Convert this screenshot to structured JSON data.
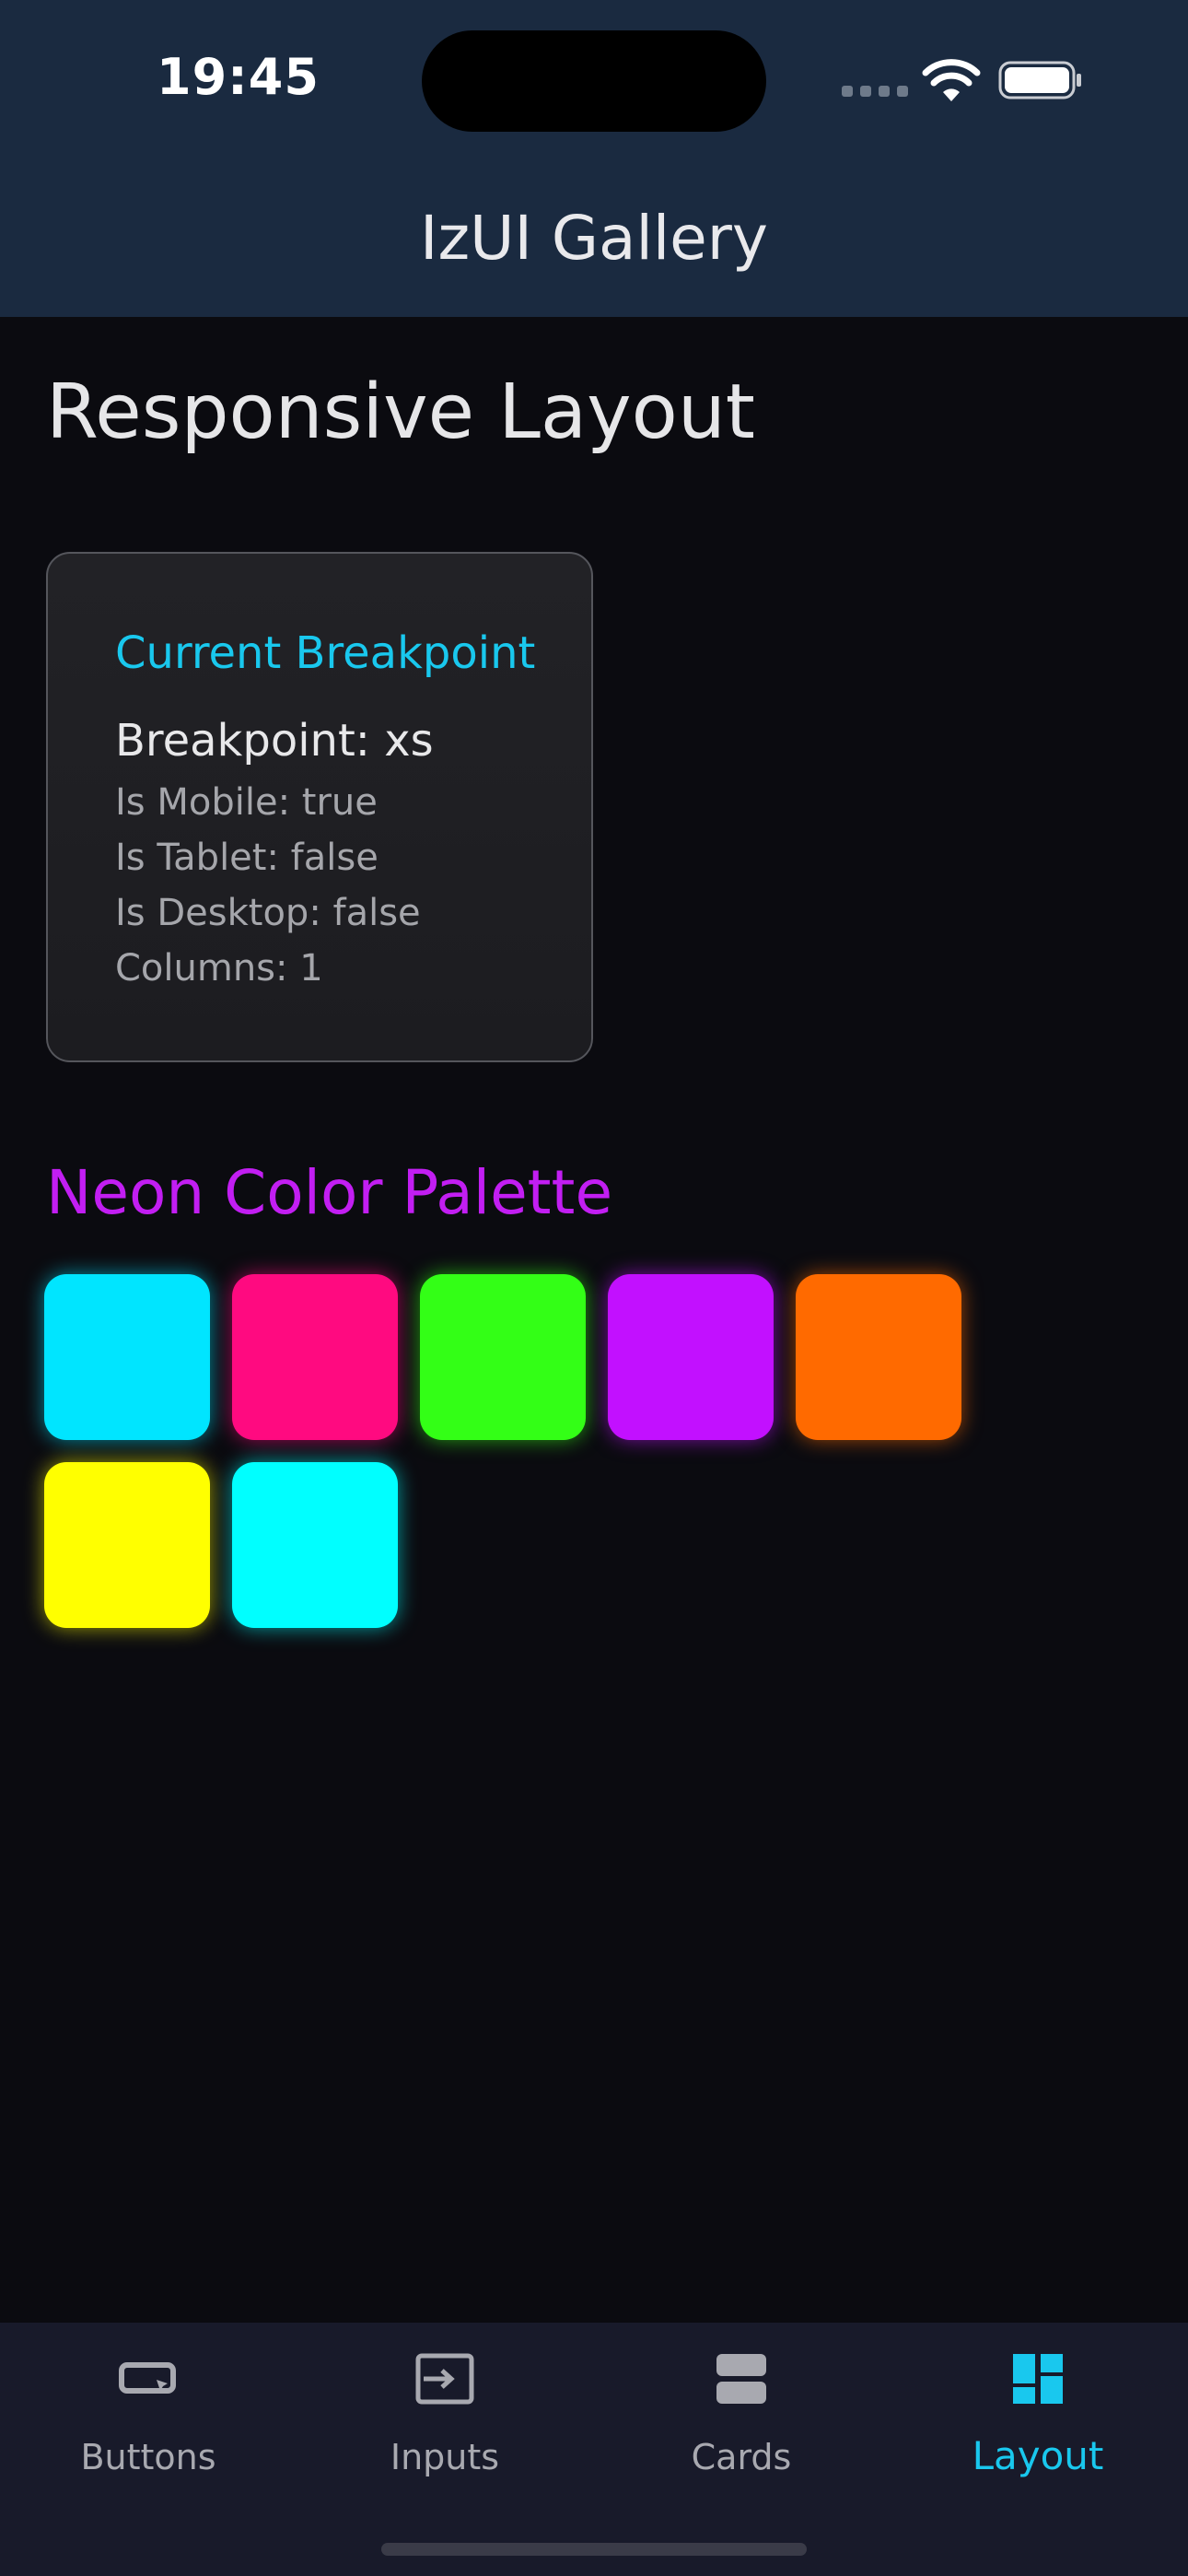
{
  "status_bar": {
    "time": "19:45"
  },
  "header": {
    "title": "IzUI Gallery"
  },
  "page": {
    "heading": "Responsive Layout"
  },
  "breakpoint_card": {
    "title": "Current Breakpoint",
    "breakpoint": "Breakpoint: xs",
    "is_mobile": "Is Mobile: true",
    "is_tablet": "Is Tablet: false",
    "is_desktop": "Is Desktop: false",
    "columns": "Columns: 1"
  },
  "palette": {
    "heading": "Neon Color Palette",
    "colors": [
      "#00e5ff",
      "#ff0a80",
      "#33ff16",
      "#c210ff",
      "#ff6a00",
      "#ffff00",
      "#00ffff"
    ]
  },
  "tabbar": {
    "tabs": [
      {
        "label": "Buttons",
        "icon": "button-icon",
        "active": false
      },
      {
        "label": "Inputs",
        "icon": "input-icon",
        "active": false
      },
      {
        "label": "Cards",
        "icon": "cards-icon",
        "active": false
      },
      {
        "label": "Layout",
        "icon": "dashboard-icon",
        "active": true
      }
    ],
    "active_color": "#19c8ee",
    "inactive_color": "#a8a9b0"
  }
}
